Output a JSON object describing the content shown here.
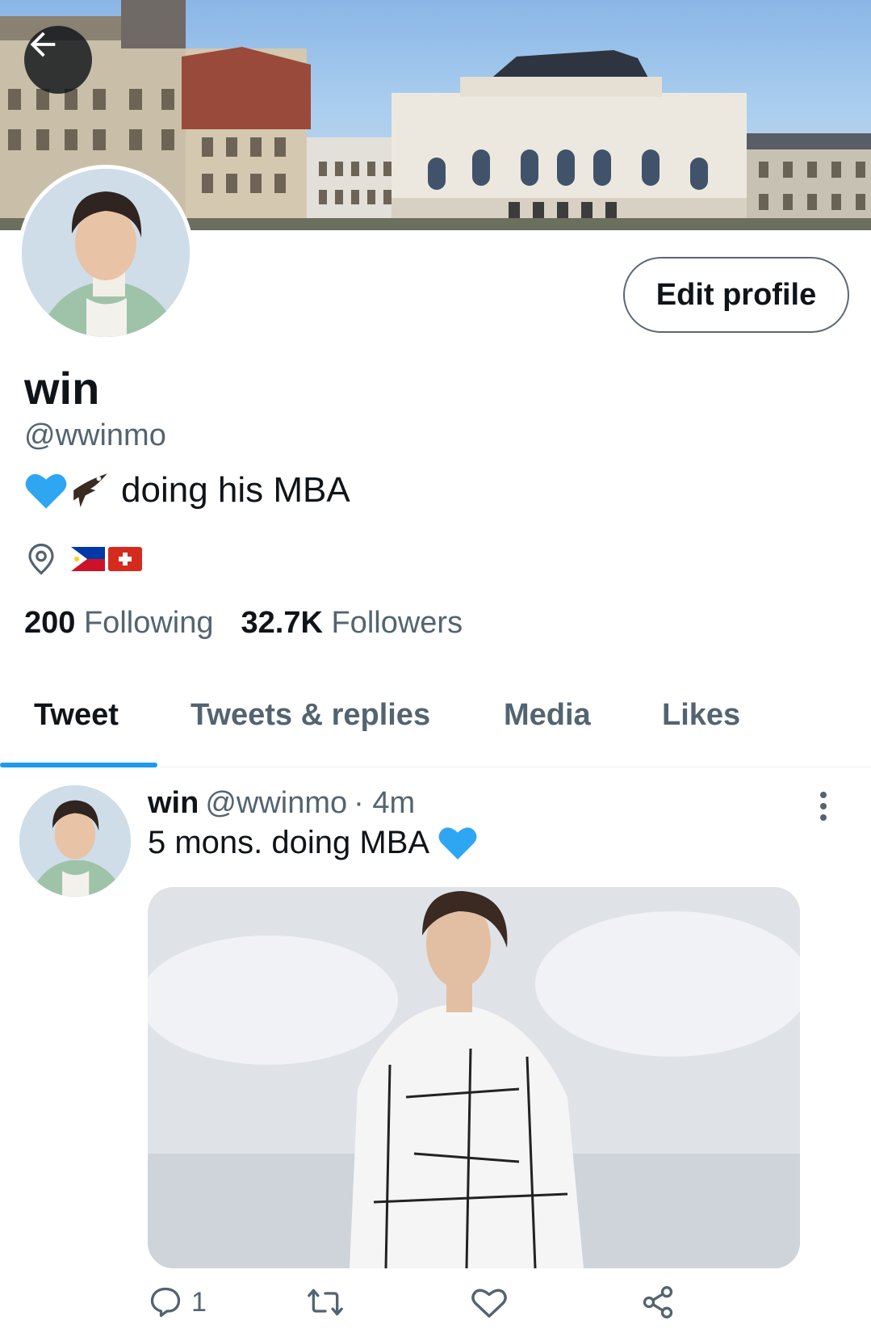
{
  "header": {
    "back_icon": "arrow-left-icon"
  },
  "profile": {
    "name": "win",
    "handle": "@wwinmo",
    "bio_text": "doing his MBA",
    "bio_emojis": [
      "blue-heart",
      "eagle"
    ],
    "location_icon": "location-pin-icon",
    "location_flags": [
      "philippines-flag",
      "switzerland-flag"
    ],
    "edit_button_label": "Edit profile",
    "following_count": "200",
    "following_label": "Following",
    "followers_count": "32.7K",
    "followers_label": "Followers"
  },
  "tabs": [
    {
      "label": "Tweet",
      "active": true
    },
    {
      "label": "Tweets & replies",
      "active": false
    },
    {
      "label": "Media",
      "active": false
    },
    {
      "label": "Likes",
      "active": false
    }
  ],
  "tweet": {
    "name": "win",
    "handle": "@wwinmo",
    "time": "· 4m",
    "text": "5 mons. doing MBA",
    "reply_count": "1"
  },
  "colors": {
    "accent": "#1d9bf0",
    "text_primary": "#0f1419",
    "text_secondary": "#536471"
  }
}
